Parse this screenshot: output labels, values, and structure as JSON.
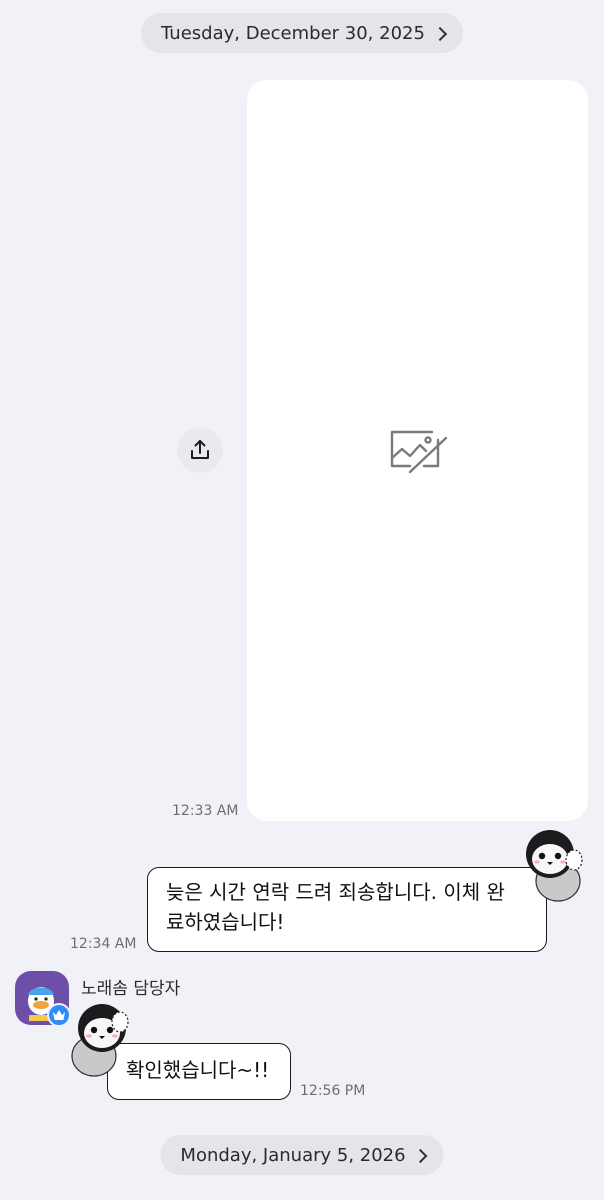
{
  "date_separators": [
    {
      "label": "Tuesday, December 30, 2025"
    },
    {
      "label": "Monday, January 5, 2026"
    }
  ],
  "messages": [
    {
      "type": "image",
      "direction": "outgoing",
      "time": "12:33 AM",
      "status_icon": "broken-image-icon",
      "action_icon": "share-icon"
    },
    {
      "type": "text",
      "direction": "outgoing",
      "text_line1": "늦은 시간 연락 드려 죄송합니다. 이체 완",
      "text_line2": "료하였습니다!",
      "time": "12:34 AM",
      "sticker": "penguin-sticker"
    },
    {
      "type": "text",
      "direction": "incoming",
      "sender": "노래솜 담당자",
      "text": "확인했습니다~!!",
      "time": "12:56 PM",
      "sticker": "penguin-sticker",
      "badge_icon": "crown-icon"
    }
  ],
  "colors": {
    "background": "#f1f2f7",
    "pill": "#e4e5ea",
    "avatar": "#6e4fa8",
    "badge": "#2f8cff"
  }
}
